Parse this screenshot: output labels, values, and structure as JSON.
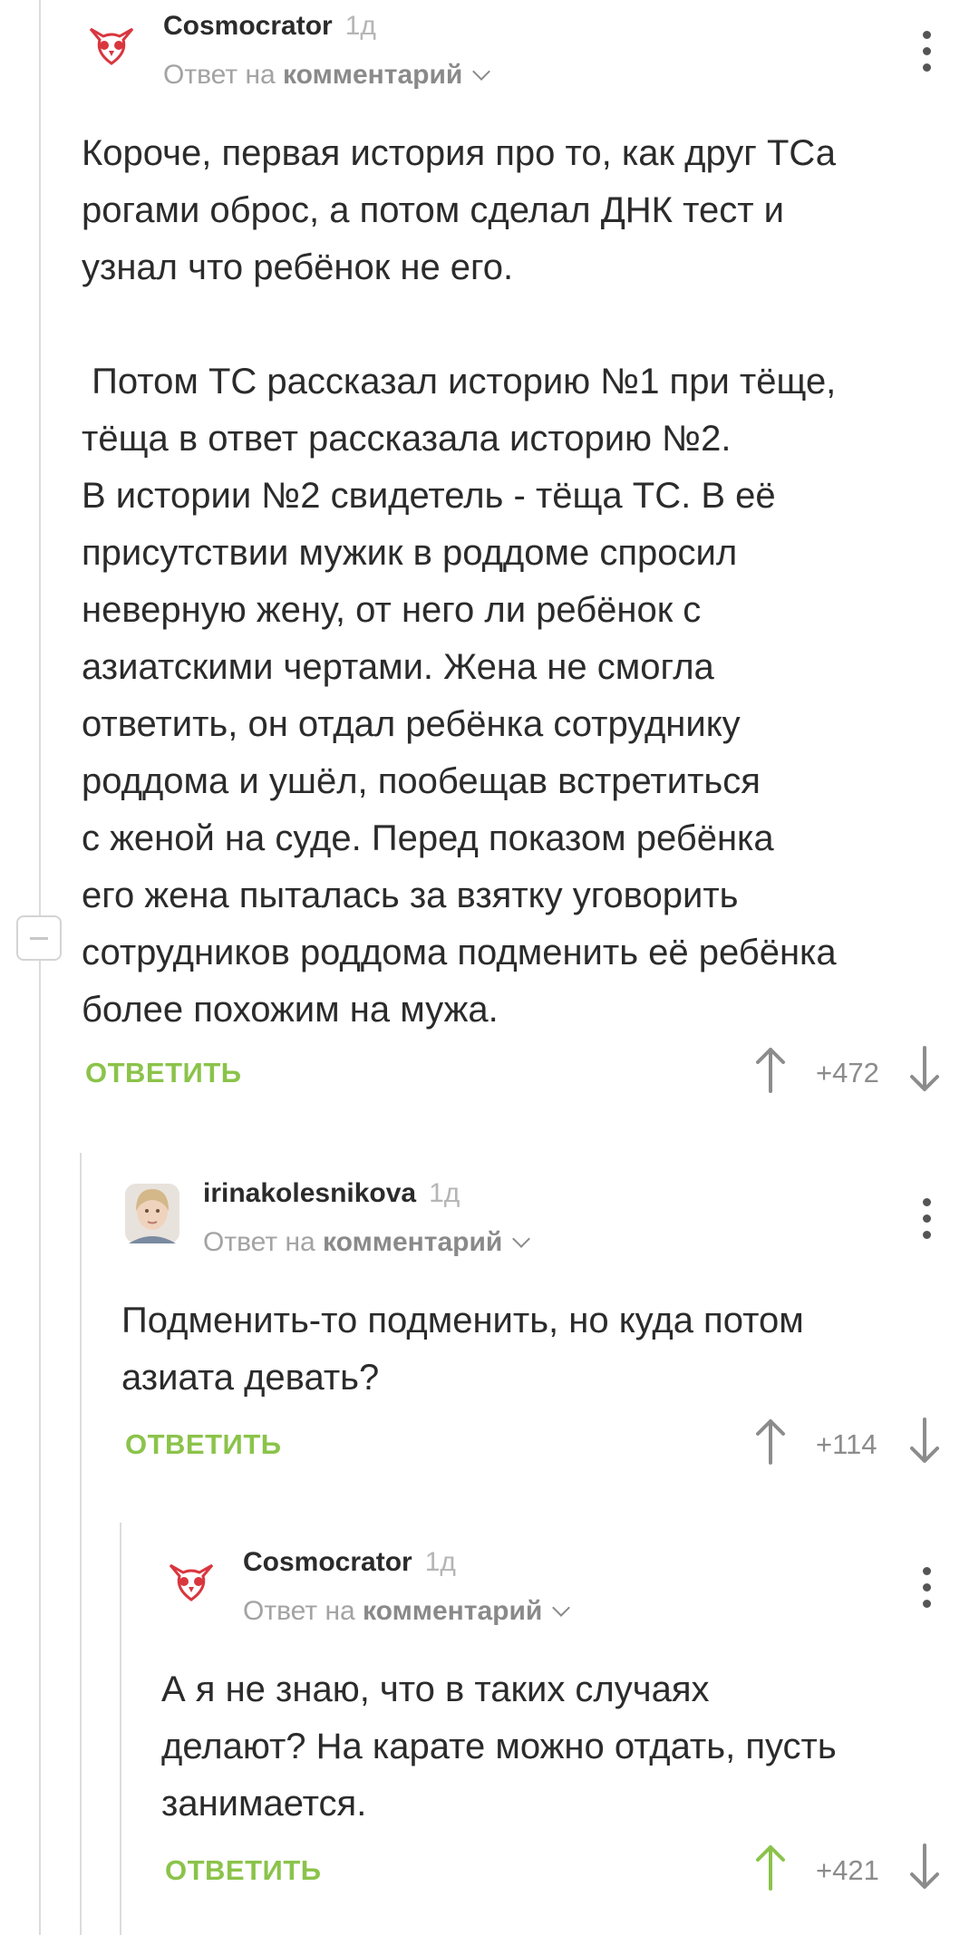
{
  "comments": [
    {
      "author": "Cosmocrator",
      "time": "1д",
      "reply_prefix": "Ответ на",
      "reply_link": "комментарий",
      "avatar_icon": "owl-logo-icon",
      "text": "Короче, первая история про то, как друг ТСа\nрогами оброс, а потом сделал ДНК тест и\nузнал что ребёнок не его.\n\n Потом ТС рассказал историю №1 при тёще,\nтёща в ответ рассказала историю №2.\nВ истории №2 свидетель - тёща ТС. В её\nприсутствии мужик в роддоме спросил\nневерную жену, от него ли ребёнок с\nазиатскими чертами. Жена не смогла\nответить, он отдал ребёнка сотруднику\nроддома и ушёл, пообещав встретиться\nс женой на суде. Перед показом ребёнка\nего жена пыталась за взятку уговорить\nсотрудников роддома подменить её ребёнка\nболее похожим на мужа.",
      "reply_label": "ОТВЕТИТЬ",
      "rating": "+472",
      "upvoted": false
    },
    {
      "author": "irinakolesnikova",
      "time": "1д",
      "reply_prefix": "Ответ на",
      "reply_link": "комментарий",
      "avatar_icon": "user-photo-avatar",
      "text": "Подменить-то подменить, но куда потом\nазиата девать?",
      "reply_label": "ОТВЕТИТЬ",
      "rating": "+114",
      "upvoted": false
    },
    {
      "author": "Cosmocrator",
      "time": "1д",
      "reply_prefix": "Ответ на",
      "reply_link": "комментарий",
      "avatar_icon": "owl-logo-icon",
      "text": "А я не знаю, что в таких случаях\nделают? На карате можно отдать, пусть\nзанимается.",
      "reply_label": "ОТВЕТИТЬ",
      "rating": "+421",
      "upvoted": true
    }
  ],
  "colors": {
    "accent_green": "#8bc34a",
    "text": "#2b2b2b",
    "muted": "#a3a3a3",
    "thread_line": "#dcdcdc",
    "owl_red": "#d9363e"
  }
}
